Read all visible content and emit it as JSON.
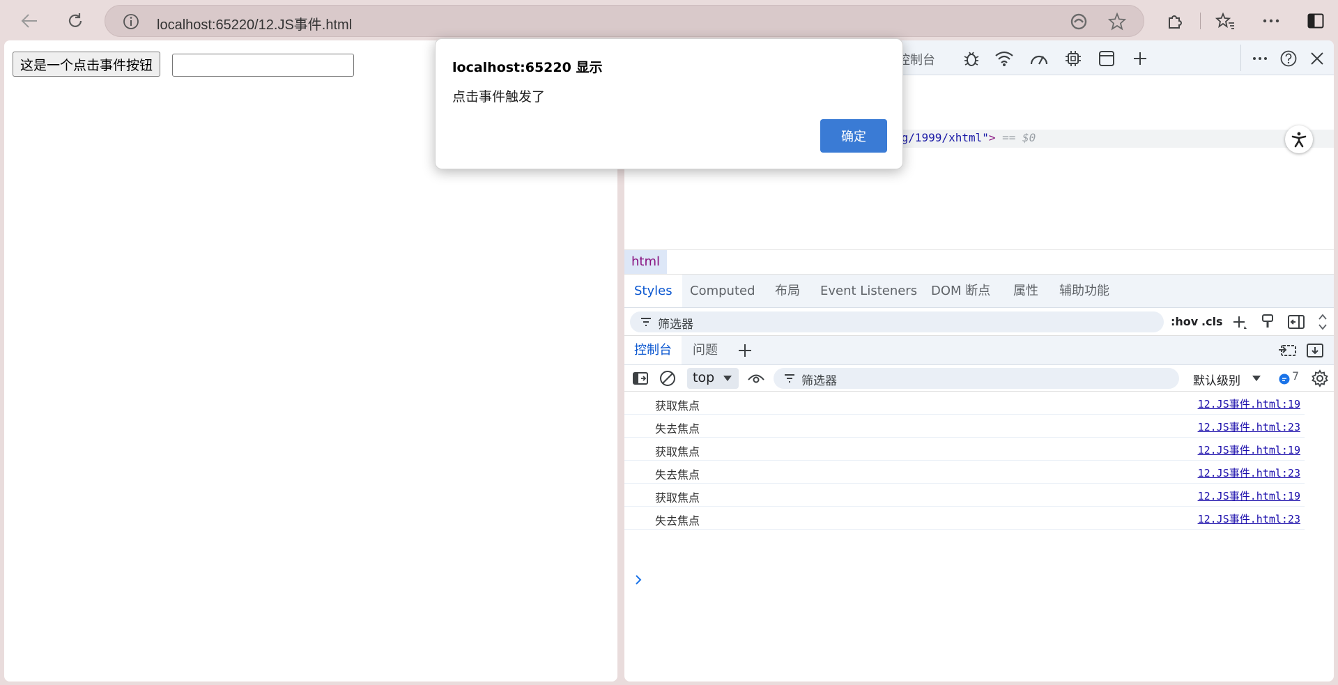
{
  "browser": {
    "url": "localhost:65220/12.JS事件.html"
  },
  "page": {
    "button_label": "这是一个点击事件按钮",
    "input_value": ""
  },
  "devtools": {
    "top_tab_visible": "控制台",
    "elements_code": {
      "attr_tail": "rg/1999/xhtml\"",
      "tag_close": ">",
      "selected_marker": "== $0"
    },
    "breadcrumb": "html",
    "styles_tabs": [
      "Styles",
      "Computed",
      "布局",
      "Event Listeners",
      "DOM 断点",
      "属性",
      "辅助功能"
    ],
    "styles_filter_placeholder": "筛选器",
    "styles_toolbar": {
      "hov": ":hov",
      "cls": ".cls"
    },
    "drawer_tabs": {
      "console": "控制台",
      "issues": "问题"
    },
    "console_toolbar": {
      "context": "top",
      "filter_placeholder": "筛选器",
      "level": "默认级别",
      "message_count": "7"
    },
    "console_messages": [
      {
        "text": "获取焦点",
        "source": "12.JS事件.html:19"
      },
      {
        "text": "失去焦点",
        "source": "12.JS事件.html:23"
      },
      {
        "text": "获取焦点",
        "source": "12.JS事件.html:19"
      },
      {
        "text": "失去焦点",
        "source": "12.JS事件.html:23"
      },
      {
        "text": "获取焦点",
        "source": "12.JS事件.html:19"
      },
      {
        "text": "失去焦点",
        "source": "12.JS事件.html:23"
      }
    ]
  },
  "alert": {
    "title": "localhost:65220 显示",
    "message": "点击事件触发了",
    "ok_label": "确定"
  },
  "colors": {
    "accent": "#3a7bd5",
    "link": "#1a0dab",
    "active_tab": "#0b57d0"
  }
}
